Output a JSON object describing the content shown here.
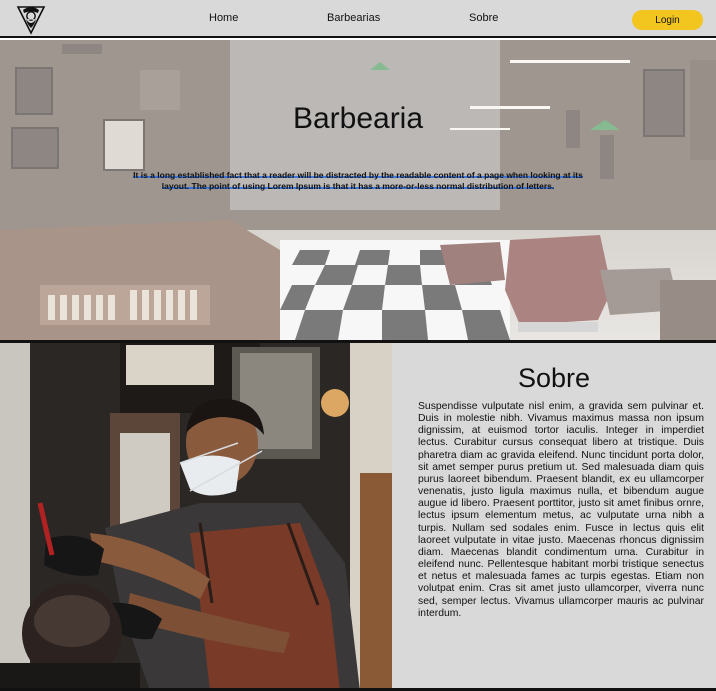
{
  "navbar": {
    "logo_icon": "bearded-barber-logo-icon",
    "links": [
      {
        "label": "Home"
      },
      {
        "label": "Barbearias"
      },
      {
        "label": "Sobre"
      }
    ],
    "login_label": "Login",
    "login_color": "#f2c61f",
    "background": "#d9d9d9"
  },
  "hero": {
    "title": "Barbearia",
    "text": "It is a long established fact that a reader will be distracted by the readable content of a page when looking at its layout. The point of using Lorem Ipsum is that it has a more-or-less normal distribution of letters."
  },
  "about": {
    "title": "Sobre",
    "text": " Suspendisse vulputate nisl enim, a gravida sem pulvinar et. Duis in  molestie nibh. Vivamus maximus massa non ipsum dignissim, at euismod  tortor iaculis.  Integer in imperdiet lectus. Curabitur cursus consequat libero at  tristique. Duis pharetra diam ac gravida eleifend. Nunc tincidunt porta  dolor, sit amet semper purus pretium ut. Sed malesuada diam quis purus  laoreet bibendum. Praesent blandit, ex eu ullamcorper venenatis, justo  ligula maximus nulla, et bibendum augue augue id libero. Praesent  porttitor, justo sit amet finibus ornre, lectus ipsum elementum metus,  ac vulputate urna nibh a turpis. Nullam sed sodales enim. Fusce in  lectus quis elit laoreet vulputate in vitae justo. Maecenas rhoncus  dignissim diam. Maecenas blandit condimentum urna. Curabitur in eleifend  nunc. Pellentesque habitant morbi tristique senectus et netus et  malesuada fames ac turpis egestas. Etiam non volutpat enim. Cras sit  amet justo ullamcorper, viverra nunc sed, semper lectus. Vivamus ullamcorper mauris ac pulvinar interdum.",
    "background": "#d9d9d9"
  }
}
